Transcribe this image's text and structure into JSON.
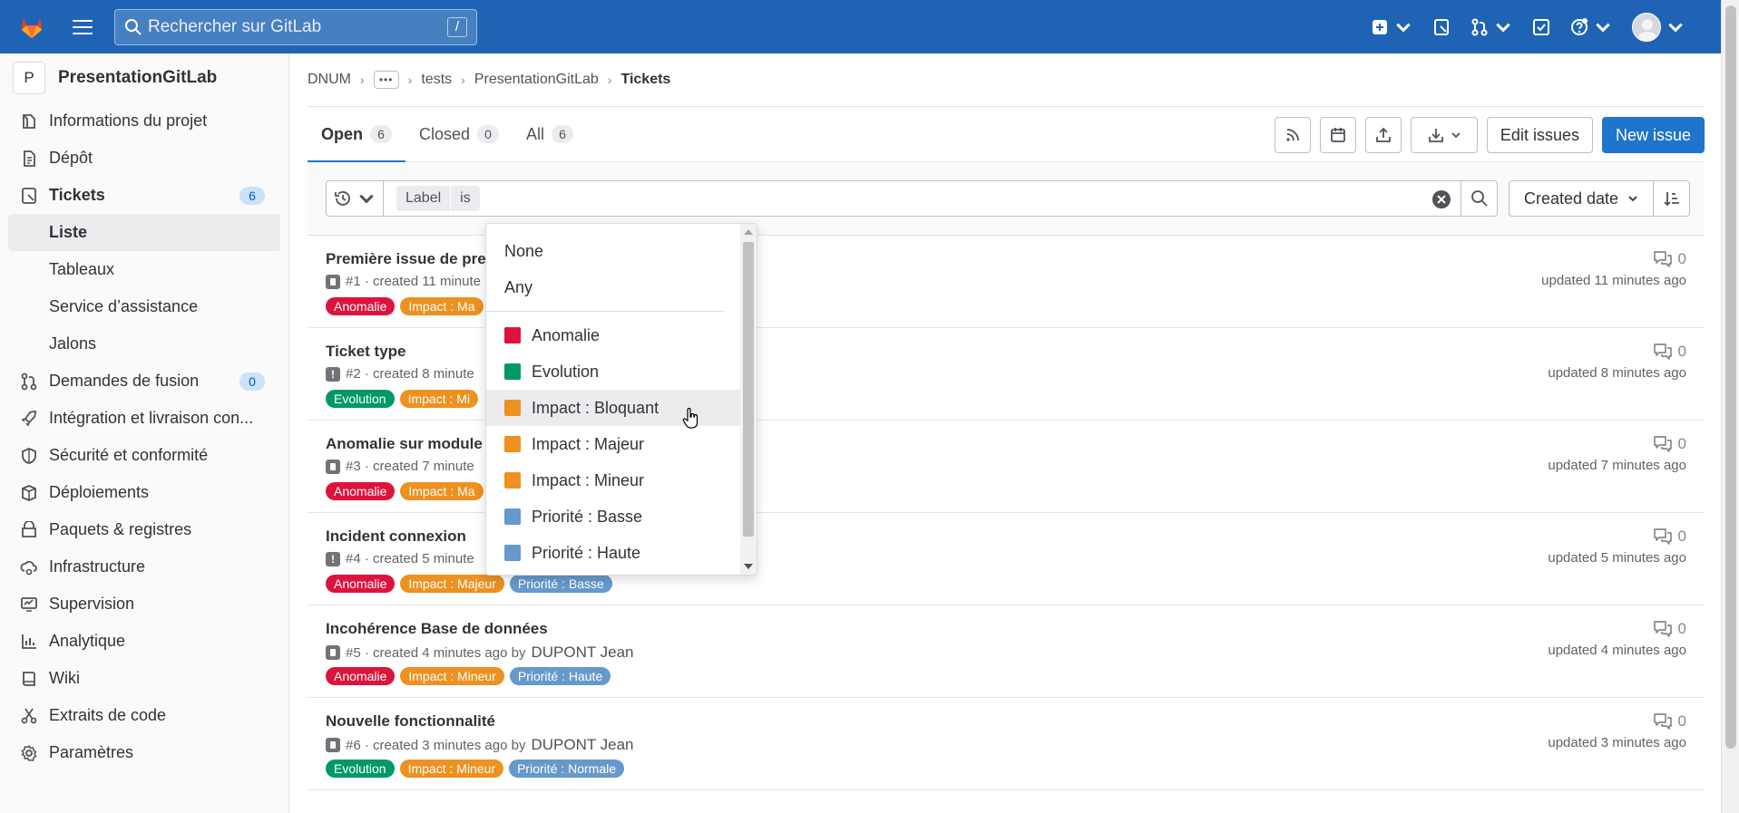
{
  "topbar": {
    "search_placeholder": "Rechercher sur GitLab",
    "search_shortcut": "/"
  },
  "project": {
    "avatar_letter": "P",
    "name": "PresentationGitLab"
  },
  "sidebar": {
    "items": [
      {
        "label": "Informations du projet",
        "icon": "project-icon"
      },
      {
        "label": "Dépôt",
        "icon": "repository-icon"
      },
      {
        "label": "Tickets",
        "icon": "issues-icon",
        "count": "6"
      },
      {
        "label": "Liste"
      },
      {
        "label": "Tableaux"
      },
      {
        "label": "Service d’assistance"
      },
      {
        "label": "Jalons"
      },
      {
        "label": "Demandes de fusion",
        "icon": "merge-request-icon",
        "count": "0"
      },
      {
        "label": "Intégration et livraison con...",
        "icon": "rocket-icon"
      },
      {
        "label": "Sécurité et conformité",
        "icon": "shield-icon"
      },
      {
        "label": "Déploiements",
        "icon": "deployments-icon"
      },
      {
        "label": "Paquets & registres",
        "icon": "package-icon"
      },
      {
        "label": "Infrastructure",
        "icon": "cloud-gear-icon"
      },
      {
        "label": "Supervision",
        "icon": "monitor-icon"
      },
      {
        "label": "Analytique",
        "icon": "chart-icon"
      },
      {
        "label": "Wiki",
        "icon": "book-icon"
      },
      {
        "label": "Extraits de code",
        "icon": "snippet-icon"
      },
      {
        "label": "Paramètres",
        "icon": "settings-icon"
      }
    ]
  },
  "breadcrumb": {
    "items": [
      "DNUM",
      "tests",
      "PresentationGitLab",
      "Tickets"
    ],
    "more": "•••"
  },
  "tabs": [
    {
      "label": "Open",
      "count": "6"
    },
    {
      "label": "Closed",
      "count": "0"
    },
    {
      "label": "All",
      "count": "6"
    }
  ],
  "actions": {
    "edit_issues": "Edit issues",
    "new_issue": "New issue"
  },
  "filter": {
    "token_key": "Label",
    "token_op": "is",
    "sort_label": "Created date"
  },
  "dropdown": {
    "special": [
      "None",
      "Any"
    ],
    "labels": [
      {
        "name": "Anomalie",
        "color": "#dc143c"
      },
      {
        "name": "Evolution",
        "color": "#009966"
      },
      {
        "name": "Impact : Bloquant",
        "color": "#ed9121"
      },
      {
        "name": "Impact : Majeur",
        "color": "#ed9121"
      },
      {
        "name": "Impact : Mineur",
        "color": "#ed9121"
      },
      {
        "name": "Priorité : Basse",
        "color": "#6699cc"
      },
      {
        "name": "Priorité : Haute",
        "color": "#6699cc"
      }
    ]
  },
  "colors": {
    "anomalie": "#dc143c",
    "evolution": "#009966",
    "impact": "#ed9121",
    "priorite": "#6699cc",
    "primary": "#1f75cb",
    "header": "#1f64b4"
  },
  "issues": [
    {
      "title": "Première issue de pre",
      "ref": "#1 · created 11 minute",
      "author": "",
      "type": "doc",
      "labels": [
        {
          "name": "Anomalie",
          "color": "#dc143c"
        },
        {
          "name": "Impact : Ma",
          "color": "#ed9121"
        }
      ],
      "comments": "0",
      "updated": "updated 11 minutes ago"
    },
    {
      "title": "Ticket type",
      "ref": "#2 · created 8 minute",
      "author": "",
      "type": "alert",
      "labels": [
        {
          "name": "Evolution",
          "color": "#009966"
        },
        {
          "name": "Impact : Mi",
          "color": "#ed9121"
        }
      ],
      "comments": "0",
      "updated": "updated 8 minutes ago"
    },
    {
      "title": "Anomalie sur module",
      "ref": "#3 · created 7 minute",
      "author": "",
      "type": "doc",
      "labels": [
        {
          "name": "Anomalie",
          "color": "#dc143c"
        },
        {
          "name": "Impact : Ma",
          "color": "#ed9121"
        }
      ],
      "comments": "0",
      "updated": "updated 7 minutes ago"
    },
    {
      "title": "Incident connexion",
      "ref": "#4 · created 5 minute",
      "author": "",
      "type": "alert",
      "labels": [
        {
          "name": "Anomalie",
          "color": "#dc143c"
        },
        {
          "name": "Impact : Majeur",
          "color": "#ed9121"
        },
        {
          "name": "Priorité : Basse",
          "color": "#6699cc"
        }
      ],
      "comments": "0",
      "updated": "updated 5 minutes ago"
    },
    {
      "title": "Incohérence Base de données",
      "ref": "#5 · created 4 minutes ago by",
      "author": "DUPONT Jean",
      "type": "doc",
      "labels": [
        {
          "name": "Anomalie",
          "color": "#dc143c"
        },
        {
          "name": "Impact : Mineur",
          "color": "#ed9121"
        },
        {
          "name": "Priorité : Haute",
          "color": "#6699cc"
        }
      ],
      "comments": "0",
      "updated": "updated 4 minutes ago"
    },
    {
      "title": "Nouvelle fonctionnalité",
      "ref": "#6 · created 3 minutes ago by",
      "author": "DUPONT Jean",
      "type": "doc",
      "labels": [
        {
          "name": "Evolution",
          "color": "#009966"
        },
        {
          "name": "Impact : Mineur",
          "color": "#ed9121"
        },
        {
          "name": "Priorité : Normale",
          "color": "#6699cc"
        }
      ],
      "comments": "0",
      "updated": "updated 3 minutes ago"
    }
  ]
}
